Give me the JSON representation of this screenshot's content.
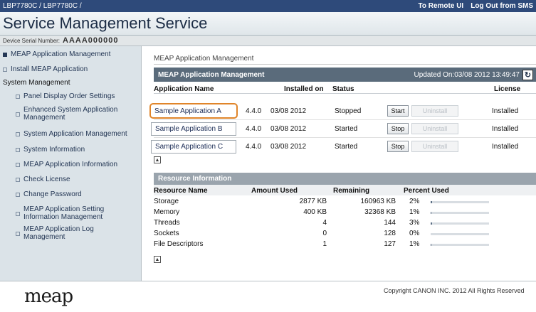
{
  "topbar": {
    "device": "LBP7780C / LBP7780C /",
    "remote_link": "To Remote UI",
    "logout_link": "Log Out from SMS"
  },
  "app_title": "Service Management Service",
  "serial": {
    "label": "Device Serial Number:",
    "value": "AAAA000000"
  },
  "sidebar": {
    "item_meap_mgmt": "MEAP Application Management",
    "item_install": "Install MEAP Application",
    "section_system": "System Management",
    "sub_items": [
      "Panel Display Order Settings",
      "Enhanced System Application Management",
      "System Application Management",
      "System Information",
      "MEAP Application Information",
      "Check License",
      "Change Password",
      "MEAP Application Setting Information Management",
      "MEAP Application Log Management"
    ]
  },
  "main": {
    "breadcrumb": "MEAP Application Management",
    "panel_title": "MEAP Application Management",
    "updated": "Updated On:03/08 2012 13:49:47",
    "columns": {
      "name": "Application Name",
      "installed": "Installed on",
      "status": "Status",
      "license": "License"
    },
    "apps": [
      {
        "name": "Sample Application A",
        "version": "4.4.0",
        "installed_on": "03/08 2012",
        "status": "Stopped",
        "action": "Start",
        "uninstall": "Uninstall",
        "license": "Installed"
      },
      {
        "name": "Sample Application B",
        "version": "4.4.0",
        "installed_on": "03/08 2012",
        "status": "Started",
        "action": "Stop",
        "uninstall": "Uninstall",
        "license": "Installed"
      },
      {
        "name": "Sample Application C",
        "version": "4.4.0",
        "installed_on": "03/08 2012",
        "status": "Started",
        "action": "Stop",
        "uninstall": "Uninstall",
        "license": "Installed"
      }
    ],
    "resource": {
      "title": "Resource Information",
      "columns": {
        "name": "Resource Name",
        "used": "Amount Used",
        "remaining": "Remaining",
        "percent": "Percent Used"
      },
      "rows": [
        {
          "name": "Storage",
          "used": "2877 KB",
          "remaining": "160963 KB",
          "percent": "2%",
          "pct_value": 2
        },
        {
          "name": "Memory",
          "used": "400 KB",
          "remaining": "32368 KB",
          "percent": "1%",
          "pct_value": 1
        },
        {
          "name": "Threads",
          "used": "4",
          "remaining": "144",
          "percent": "3%",
          "pct_value": 3
        },
        {
          "name": "Sockets",
          "used": "0",
          "remaining": "128",
          "percent": "0%",
          "pct_value": 0
        },
        {
          "name": "File Descriptors",
          "used": "1",
          "remaining": "127",
          "percent": "1%",
          "pct_value": 1
        }
      ]
    }
  },
  "footer": {
    "logo": "meap",
    "copyright": "Copyright CANON INC. 2012 All Rights Reserved"
  },
  "colors": {
    "topbar": "#2e4a7a",
    "panel_head": "#5a6b7b",
    "highlight": "#e0852a",
    "sidebar": "#dbe3e8"
  }
}
